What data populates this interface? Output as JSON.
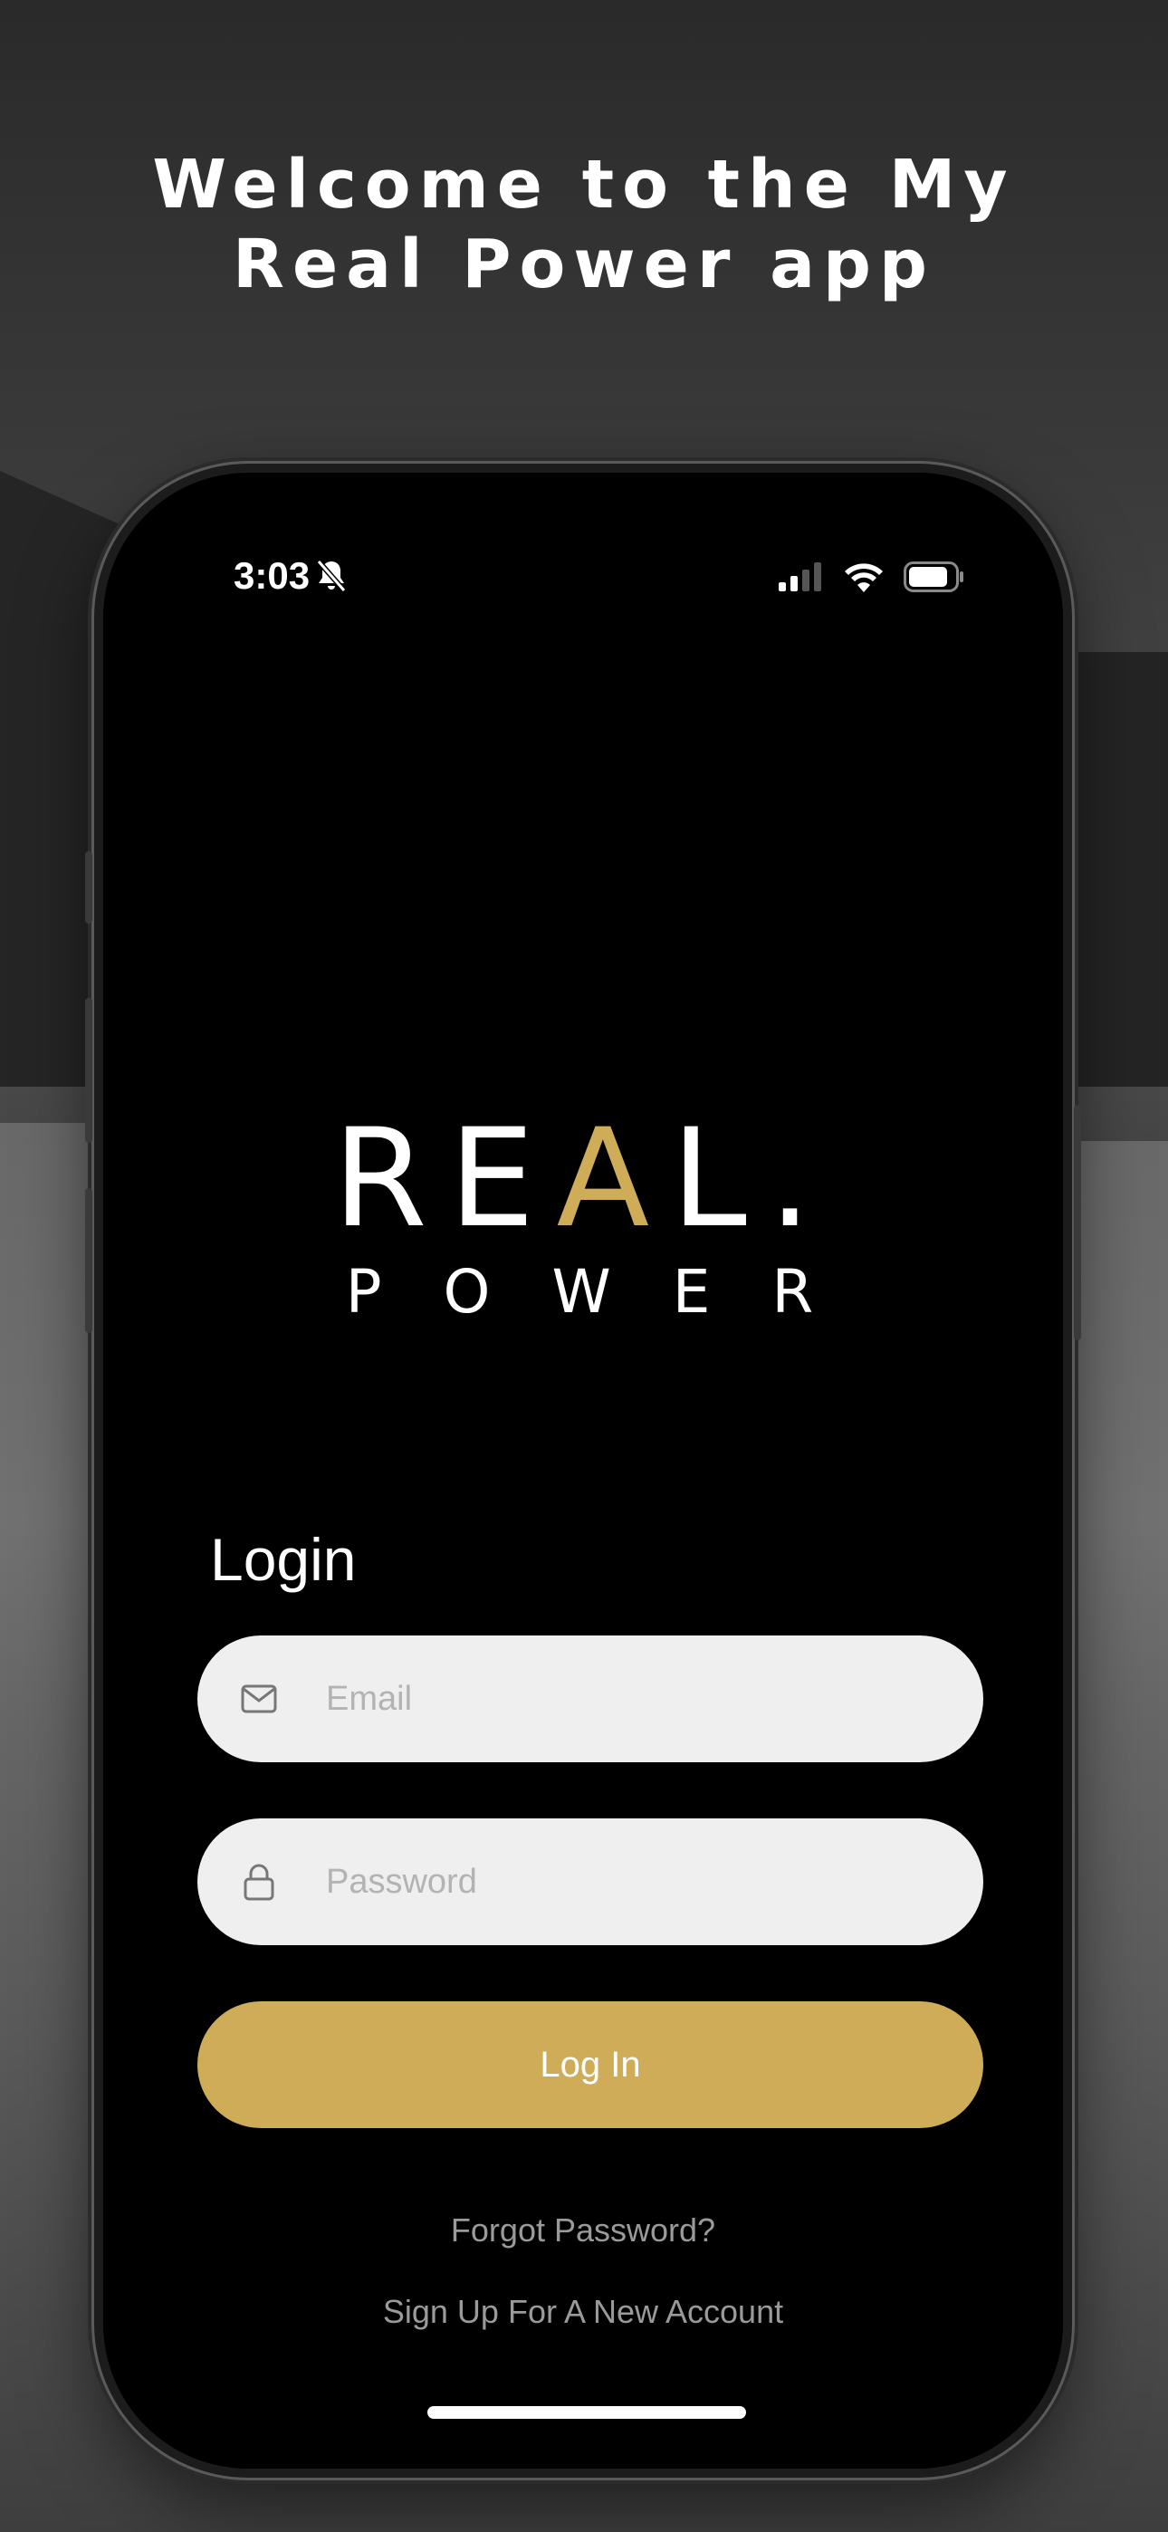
{
  "headline": {
    "line1": "Welcome to the My",
    "line2": "Real Power app"
  },
  "status_bar": {
    "time": "3:03",
    "silent_icon": "bell-slash-icon",
    "signal_icon": "cellular-signal-icon",
    "wifi_icon": "wifi-icon",
    "battery_icon": "battery-icon"
  },
  "logo": {
    "word_part1": "RE",
    "word_accent": "A",
    "word_part2": "L.",
    "subtitle": "POWER"
  },
  "login": {
    "title": "Login",
    "email_placeholder": "Email",
    "email_icon": "envelope-icon",
    "password_placeholder": "Password",
    "password_icon": "lock-icon",
    "login_label": "Log In",
    "forgot_password": "Forgot Password?",
    "sign_up": "Sign Up For A New Account"
  },
  "colors": {
    "accent": "#cfad58",
    "field_bg": "#efefef",
    "screen_bg": "#000000",
    "link_text": "#9a9a9a"
  }
}
